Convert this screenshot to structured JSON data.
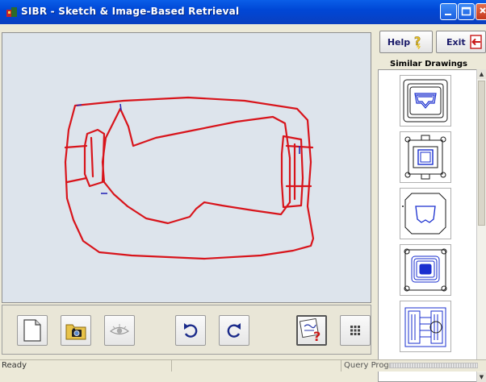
{
  "window": {
    "title": "SIBR - Sketch & Image-Based Retrieval"
  },
  "header_buttons": {
    "help_label": "Help",
    "exit_label": "Exit"
  },
  "results_panel": {
    "title": "Similar Drawings",
    "thumbnails": [
      "result-1",
      "result-2",
      "result-3",
      "result-4",
      "result-5"
    ]
  },
  "toolbar": {
    "buttons": [
      "new-document-icon",
      "open-camera-folder-icon",
      "view-eye-icon",
      "undo-icon",
      "redo-icon",
      "query-help-icon",
      "grid-options-icon"
    ]
  },
  "status": {
    "text": "Ready",
    "progress_label": "Query Progress:",
    "progress": 0
  },
  "colors": {
    "title_bar": "#0a50dd",
    "sketch_stroke": "#d8141b",
    "canvas_bg": "#dde4ec",
    "thumb_stroke": "#1a2fcf"
  }
}
